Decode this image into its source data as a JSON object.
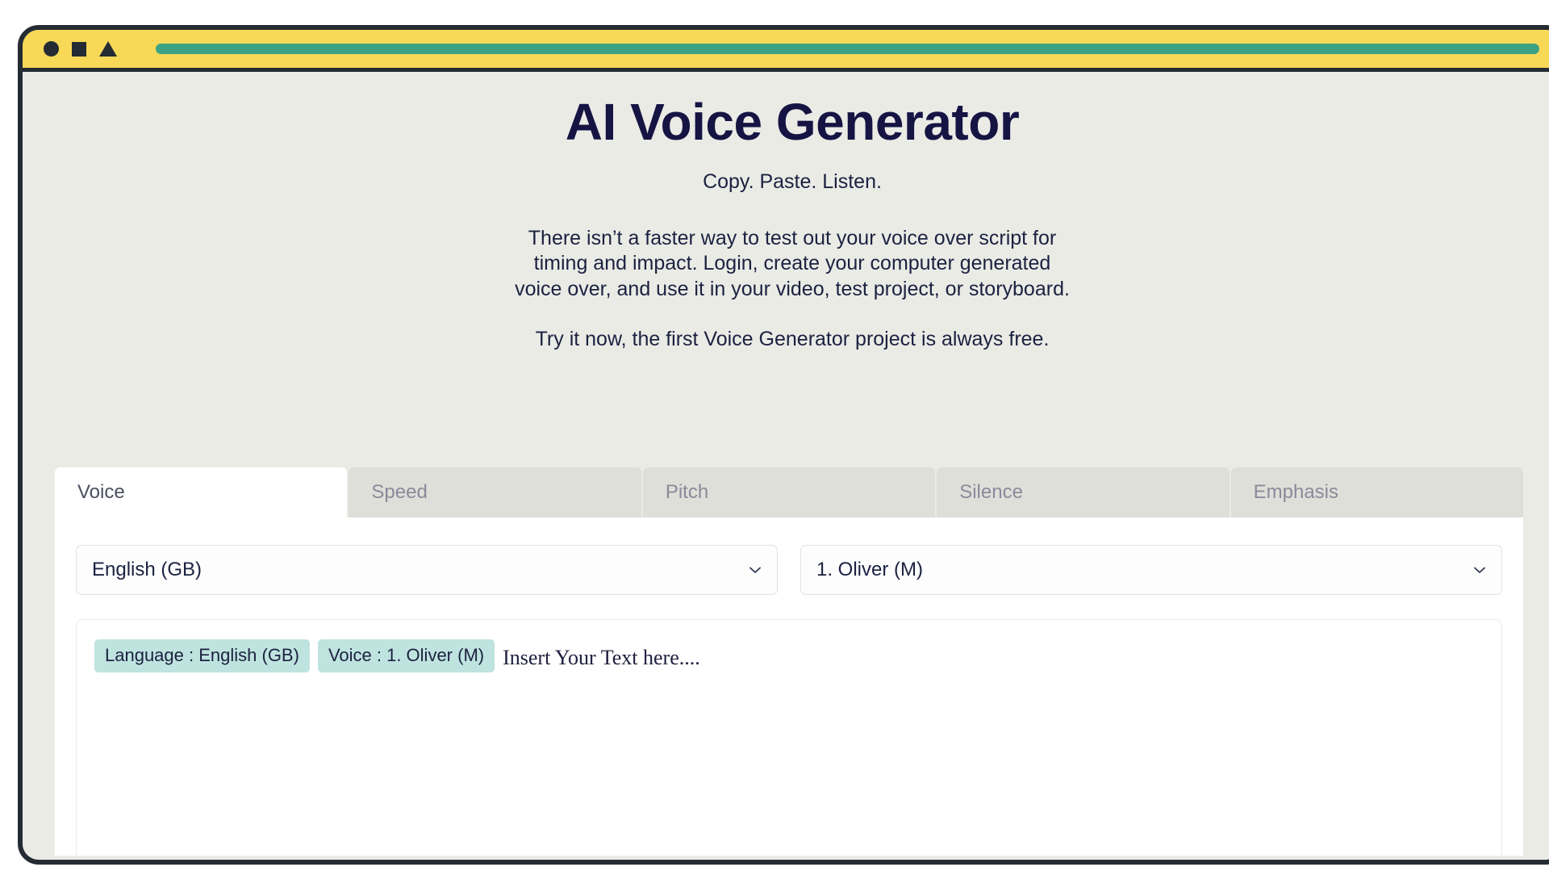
{
  "browser": {
    "controls": [
      "circle",
      "square",
      "triangle"
    ],
    "address_bar_value": ""
  },
  "hero": {
    "title": "AI Voice Generator",
    "tagline": "Copy. Paste. Listen.",
    "paragraph_1": "There isn’t a faster way to test out your voice over script for timing and impact. Login, create your computer generated voice over, and use it in your video, test project, or storyboard.",
    "paragraph_2": "Try it now, the first Voice Generator project is always free."
  },
  "tabs": [
    {
      "label": "Voice",
      "active": true
    },
    {
      "label": "Speed",
      "active": false
    },
    {
      "label": "Pitch",
      "active": false
    },
    {
      "label": "Silence",
      "active": false
    },
    {
      "label": "Emphasis",
      "active": false
    }
  ],
  "controls": {
    "language_select": {
      "value": "English (GB)",
      "icon": "chevron-down-icon"
    },
    "voice_select": {
      "value": "1. Oliver (M)",
      "icon": "chevron-down-icon"
    }
  },
  "editor": {
    "chips": [
      "Language : English (GB)",
      "Voice : 1. Oliver (M)"
    ],
    "placeholder": "Insert Your Text here...."
  },
  "colors": {
    "titlebar_yellow": "#f7d857",
    "addressbar_green": "#3ba284",
    "frame_dark": "#242b33",
    "page_beige": "#ebebe6",
    "title_navy": "#151443",
    "chip_teal": "#bfe3df",
    "tab_inactive": "#dfdfda"
  }
}
